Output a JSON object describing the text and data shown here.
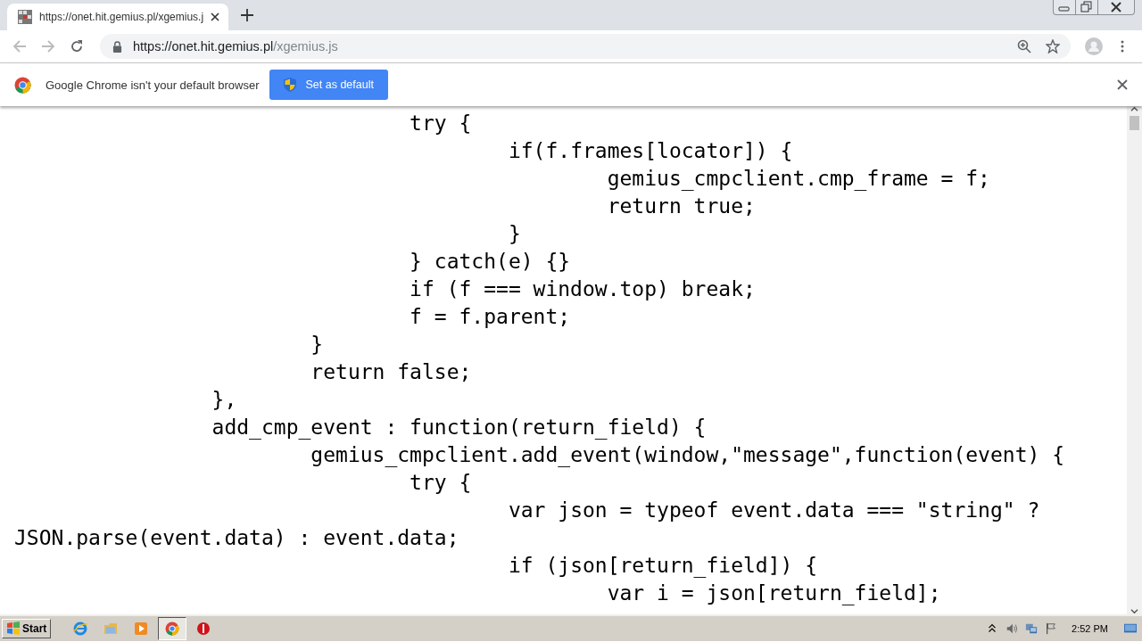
{
  "tab": {
    "title": "https://onet.hit.gemius.pl/xgemius.j",
    "selected": true
  },
  "address": {
    "host": "https://onet.hit.gemius.pl",
    "path": "/xgemius.js"
  },
  "infobar": {
    "message": "Google Chrome isn't your default browser",
    "button": "Set as default"
  },
  "code_lines": [
    "\t\t\t\ttry {",
    "\t\t\t\t\tif(f.frames[locator]) {",
    "\t\t\t\t\t\tgemius_cmpclient.cmp_frame = f;",
    "\t\t\t\t\t\treturn true;",
    "\t\t\t\t\t}",
    "\t\t\t\t} catch(e) {}",
    "\t\t\t\tif (f === window.top) break;",
    "\t\t\t\tf = f.parent;",
    "\t\t\t}",
    "\t\t\treturn false;",
    "\t\t},",
    "\t\tadd_cmp_event : function(return_field) {",
    "\t\t\tgemius_cmpclient.add_event(window,\"message\",function(event) {",
    "\t\t\t\ttry {",
    "\t\t\t\t\tvar json = typeof event.data === \"string\" ?",
    "JSON.parse(event.data) : event.data;",
    "\t\t\t\t\tif (json[return_field]) {",
    "\t\t\t\t\t\tvar i = json[return_field];"
  ],
  "taskbar": {
    "start": "Start",
    "clock": "2:52 PM"
  }
}
